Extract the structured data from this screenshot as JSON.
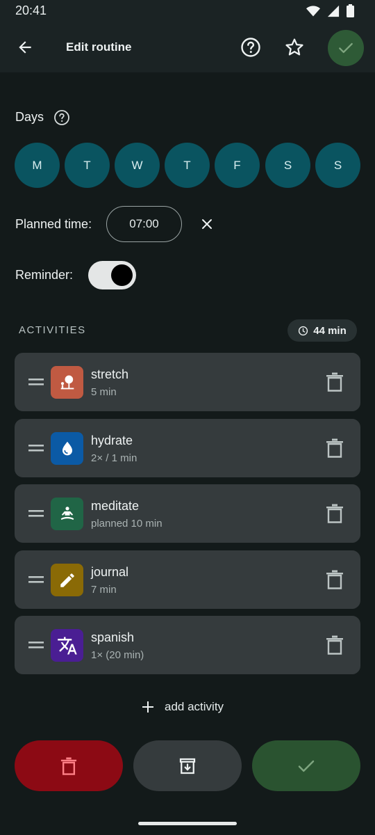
{
  "status_bar": {
    "time": "20:41",
    "icons": [
      "wifi-icon",
      "signal-icon",
      "battery-icon"
    ]
  },
  "app_bar": {
    "title": "Edit routine",
    "back_icon": "arrow-left-icon",
    "help_icon": "help-circle-icon",
    "favorite_icon": "star-outline-icon",
    "confirm_icon": "check-icon"
  },
  "days": {
    "label": "Days",
    "items": [
      "M",
      "T",
      "W",
      "T",
      "F",
      "S",
      "S"
    ]
  },
  "planned_time": {
    "label": "Planned time:",
    "value": "07:00"
  },
  "reminder": {
    "label": "Reminder:",
    "enabled": true
  },
  "activities": {
    "header": "ACTIVITIES",
    "total": "44 min",
    "items": [
      {
        "name": "stretch",
        "detail": "5 min",
        "icon": "tree-stretch-icon",
        "color": "#c05a42"
      },
      {
        "name": "hydrate",
        "detail": "2× / 1 min",
        "icon": "water-drop-icon",
        "color": "#0b5aa5"
      },
      {
        "name": "meditate",
        "detail": "planned 10 min",
        "icon": "meditation-icon",
        "color": "#206546"
      },
      {
        "name": "journal",
        "detail": "7 min",
        "icon": "pencil-icon",
        "color": "#8a6a06"
      },
      {
        "name": "spanish",
        "detail": "1× (20 min)",
        "icon": "translate-icon",
        "color": "#4a1e93"
      }
    ],
    "add_label": "add activity"
  },
  "bottom_actions": {
    "delete_icon": "trash-icon",
    "archive_icon": "archive-icon",
    "save_icon": "check-icon",
    "colors": {
      "delete": "#8c0a14",
      "archive": "#353b3d",
      "save": "#2a5330"
    }
  }
}
